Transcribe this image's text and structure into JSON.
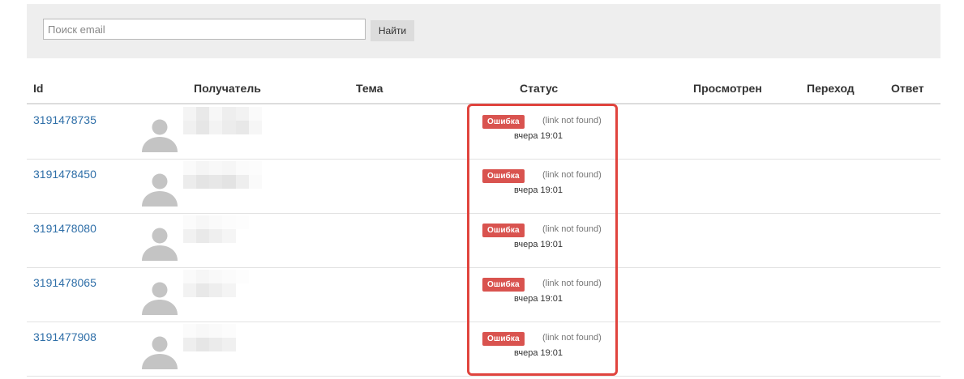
{
  "search": {
    "placeholder": "Поиск email",
    "button_label": "Найти"
  },
  "table": {
    "columns": [
      "Id",
      "Получатель",
      "Тема",
      "Статус",
      "Просмотрен",
      "Переход",
      "Ответ"
    ],
    "rows": [
      {
        "id": "3191478735",
        "status_badge": "Ошибка",
        "status_note": "(link not found)",
        "time": "вчера 19:01"
      },
      {
        "id": "3191478450",
        "status_badge": "Ошибка",
        "status_note": "(link not found)",
        "time": "вчера 19:01"
      },
      {
        "id": "3191478080",
        "status_badge": "Ошибка",
        "status_note": "(link not found)",
        "time": "вчера 19:01"
      },
      {
        "id": "3191478065",
        "status_badge": "Ошибка",
        "status_note": "(link not found)",
        "time": "вчера 19:01"
      },
      {
        "id": "3191477908",
        "status_badge": "Ошибка",
        "status_note": "(link not found)",
        "time": "вчера 19:01"
      }
    ]
  },
  "colors": {
    "link": "#2f6fa8",
    "error_badge": "#d9534f",
    "highlight": "#e0443e",
    "panel_bg": "#eeeeee"
  },
  "icons": {
    "avatar": "user-silhouette-icon"
  }
}
